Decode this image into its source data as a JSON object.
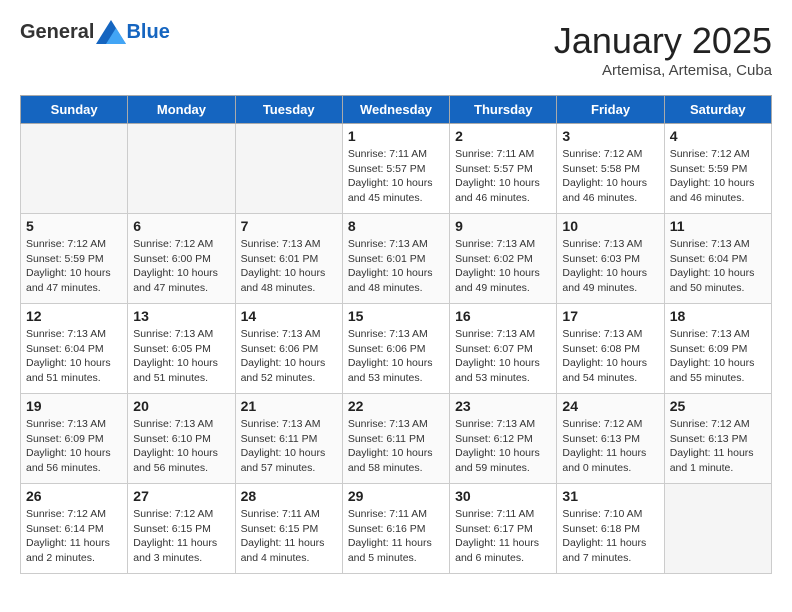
{
  "header": {
    "logo_general": "General",
    "logo_blue": "Blue",
    "month": "January 2025",
    "location": "Artemisa, Artemisa, Cuba"
  },
  "days_of_week": [
    "Sunday",
    "Monday",
    "Tuesday",
    "Wednesday",
    "Thursday",
    "Friday",
    "Saturday"
  ],
  "weeks": [
    [
      {
        "day": "",
        "empty": true
      },
      {
        "day": "",
        "empty": true
      },
      {
        "day": "",
        "empty": true
      },
      {
        "day": "1",
        "sunrise": "7:11 AM",
        "sunset": "5:57 PM",
        "daylight": "10 hours and 45 minutes."
      },
      {
        "day": "2",
        "sunrise": "7:11 AM",
        "sunset": "5:57 PM",
        "daylight": "10 hours and 46 minutes."
      },
      {
        "day": "3",
        "sunrise": "7:12 AM",
        "sunset": "5:58 PM",
        "daylight": "10 hours and 46 minutes."
      },
      {
        "day": "4",
        "sunrise": "7:12 AM",
        "sunset": "5:59 PM",
        "daylight": "10 hours and 46 minutes."
      }
    ],
    [
      {
        "day": "5",
        "sunrise": "7:12 AM",
        "sunset": "5:59 PM",
        "daylight": "10 hours and 47 minutes."
      },
      {
        "day": "6",
        "sunrise": "7:12 AM",
        "sunset": "6:00 PM",
        "daylight": "10 hours and 47 minutes."
      },
      {
        "day": "7",
        "sunrise": "7:13 AM",
        "sunset": "6:01 PM",
        "daylight": "10 hours and 48 minutes."
      },
      {
        "day": "8",
        "sunrise": "7:13 AM",
        "sunset": "6:01 PM",
        "daylight": "10 hours and 48 minutes."
      },
      {
        "day": "9",
        "sunrise": "7:13 AM",
        "sunset": "6:02 PM",
        "daylight": "10 hours and 49 minutes."
      },
      {
        "day": "10",
        "sunrise": "7:13 AM",
        "sunset": "6:03 PM",
        "daylight": "10 hours and 49 minutes."
      },
      {
        "day": "11",
        "sunrise": "7:13 AM",
        "sunset": "6:04 PM",
        "daylight": "10 hours and 50 minutes."
      }
    ],
    [
      {
        "day": "12",
        "sunrise": "7:13 AM",
        "sunset": "6:04 PM",
        "daylight": "10 hours and 51 minutes."
      },
      {
        "day": "13",
        "sunrise": "7:13 AM",
        "sunset": "6:05 PM",
        "daylight": "10 hours and 51 minutes."
      },
      {
        "day": "14",
        "sunrise": "7:13 AM",
        "sunset": "6:06 PM",
        "daylight": "10 hours and 52 minutes."
      },
      {
        "day": "15",
        "sunrise": "7:13 AM",
        "sunset": "6:06 PM",
        "daylight": "10 hours and 53 minutes."
      },
      {
        "day": "16",
        "sunrise": "7:13 AM",
        "sunset": "6:07 PM",
        "daylight": "10 hours and 53 minutes."
      },
      {
        "day": "17",
        "sunrise": "7:13 AM",
        "sunset": "6:08 PM",
        "daylight": "10 hours and 54 minutes."
      },
      {
        "day": "18",
        "sunrise": "7:13 AM",
        "sunset": "6:09 PM",
        "daylight": "10 hours and 55 minutes."
      }
    ],
    [
      {
        "day": "19",
        "sunrise": "7:13 AM",
        "sunset": "6:09 PM",
        "daylight": "10 hours and 56 minutes."
      },
      {
        "day": "20",
        "sunrise": "7:13 AM",
        "sunset": "6:10 PM",
        "daylight": "10 hours and 56 minutes."
      },
      {
        "day": "21",
        "sunrise": "7:13 AM",
        "sunset": "6:11 PM",
        "daylight": "10 hours and 57 minutes."
      },
      {
        "day": "22",
        "sunrise": "7:13 AM",
        "sunset": "6:11 PM",
        "daylight": "10 hours and 58 minutes."
      },
      {
        "day": "23",
        "sunrise": "7:13 AM",
        "sunset": "6:12 PM",
        "daylight": "10 hours and 59 minutes."
      },
      {
        "day": "24",
        "sunrise": "7:12 AM",
        "sunset": "6:13 PM",
        "daylight": "11 hours and 0 minutes."
      },
      {
        "day": "25",
        "sunrise": "7:12 AM",
        "sunset": "6:13 PM",
        "daylight": "11 hours and 1 minute."
      }
    ],
    [
      {
        "day": "26",
        "sunrise": "7:12 AM",
        "sunset": "6:14 PM",
        "daylight": "11 hours and 2 minutes."
      },
      {
        "day": "27",
        "sunrise": "7:12 AM",
        "sunset": "6:15 PM",
        "daylight": "11 hours and 3 minutes."
      },
      {
        "day": "28",
        "sunrise": "7:11 AM",
        "sunset": "6:15 PM",
        "daylight": "11 hours and 4 minutes."
      },
      {
        "day": "29",
        "sunrise": "7:11 AM",
        "sunset": "6:16 PM",
        "daylight": "11 hours and 5 minutes."
      },
      {
        "day": "30",
        "sunrise": "7:11 AM",
        "sunset": "6:17 PM",
        "daylight": "11 hours and 6 minutes."
      },
      {
        "day": "31",
        "sunrise": "7:10 AM",
        "sunset": "6:18 PM",
        "daylight": "11 hours and 7 minutes."
      },
      {
        "day": "",
        "empty": true
      }
    ]
  ]
}
